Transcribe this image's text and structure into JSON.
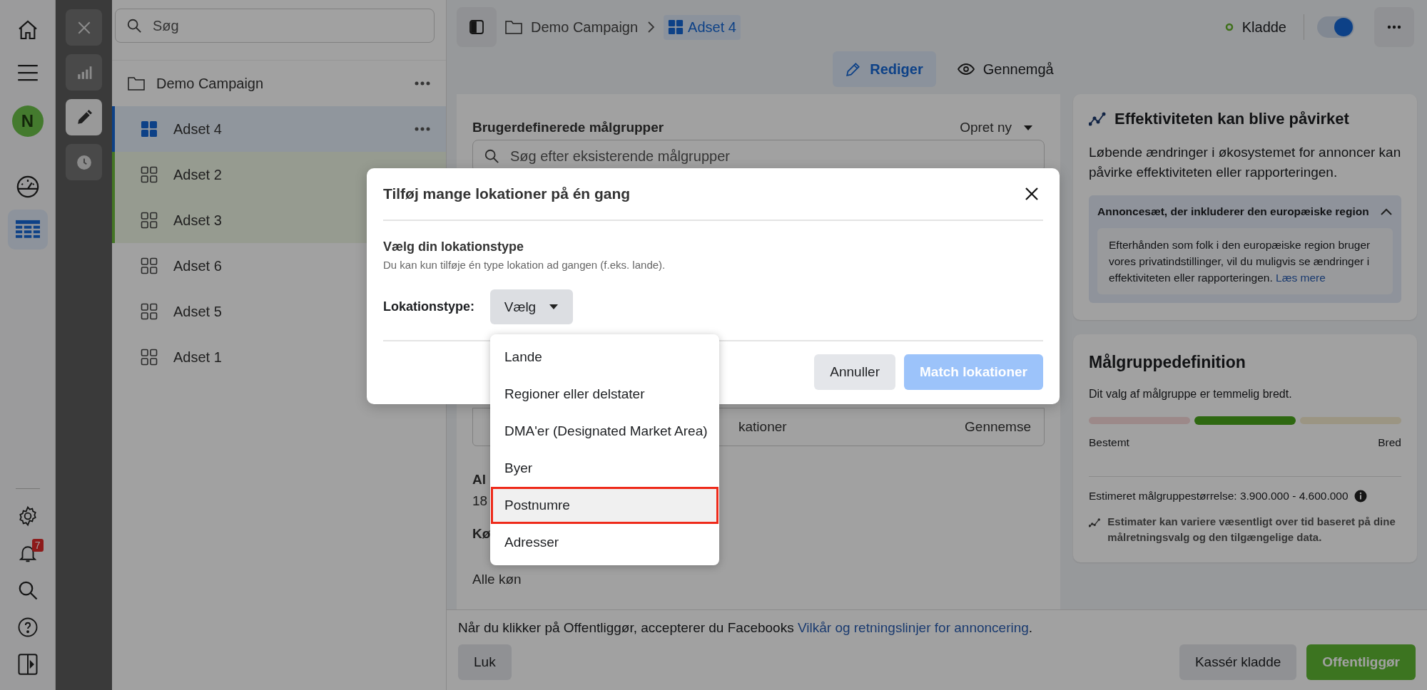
{
  "rail": {
    "top": [
      {
        "kind": "home",
        "selected": false
      },
      {
        "kind": "menu",
        "selected": false
      }
    ],
    "avatar": "N",
    "nav": [
      {
        "kind": "gauge",
        "selected": false
      },
      {
        "kind": "table",
        "selected": true
      }
    ],
    "bottom": [
      {
        "kind": "settings"
      },
      {
        "kind": "bell",
        "badge": "7"
      },
      {
        "kind": "search"
      },
      {
        "kind": "help"
      },
      {
        "kind": "panel"
      }
    ]
  },
  "tools": [
    {
      "kind": "close",
      "selected": false
    },
    {
      "kind": "chart",
      "selected": false
    },
    {
      "kind": "edit",
      "selected": true
    },
    {
      "kind": "history",
      "selected": false
    }
  ],
  "tree": {
    "search_placeholder": "Søg",
    "campaign": "Demo Campaign",
    "adsets": [
      {
        "label": "Adset 4",
        "selected": true,
        "edited": false
      },
      {
        "label": "Adset 2",
        "selected": false,
        "edited": true
      },
      {
        "label": "Adset 3",
        "selected": false,
        "edited": true
      },
      {
        "label": "Adset 6",
        "selected": false,
        "edited": false
      },
      {
        "label": "Adset 5",
        "selected": false,
        "edited": false
      },
      {
        "label": "Adset 1",
        "selected": false,
        "edited": false
      }
    ]
  },
  "topbar": {
    "campaign": "Demo Campaign",
    "adset": "Adset 4",
    "status": "Kladde",
    "toggle_on": true,
    "tabs": [
      {
        "kind": "edit",
        "label": "Rediger",
        "selected": true
      },
      {
        "kind": "review",
        "label": "Gennemgå",
        "selected": false
      }
    ]
  },
  "editor": {
    "audiences_title": "Brugerdefinerede målgrupper",
    "create": "Opret ny",
    "audiences_placeholder": "Søg efter eksisterende målgrupper",
    "locations_fragment": "kationer",
    "locations_action": "Gennemse",
    "age_label": "Al",
    "age_value": "18",
    "gender_label": "Kø",
    "gender_value": "Alle køn"
  },
  "insight": {
    "title": "Effektiviteten kan blive påvirket",
    "text": "Løbende ændringer i økosystemet for annoncer kan påvirke effektiviteten eller rapporteringen.",
    "accordion": {
      "title": "Annoncesæt, der inkluderer den europæiske region",
      "expanded": true,
      "text": "Efterhånden som folk i den europæiske region bruger vores privatindstillinger, vil du muligvis se ændringer i effektiviteten eller rapporteringen. ",
      "link": "Læs mere"
    }
  },
  "audience": {
    "title": "Målgruppedefinition",
    "text": "Dit valg af målgruppe er temmelig bredt.",
    "segments": [
      {
        "kind": "narrow",
        "selected": false
      },
      {
        "kind": "balanced",
        "selected": true
      },
      {
        "kind": "broad",
        "selected": false
      }
    ],
    "low": "Bestemt",
    "high": "Bred",
    "estimate": "Estimeret målgruppestørrelse: 3.900.000 - 4.600.000",
    "note": "Estimater kan variere væsentligt over tid baseret på dine målretningsvalg og den tilgængelige data."
  },
  "footer": {
    "notice": "Når du klikker på Offentliggør, accepterer du Facebooks ",
    "link": "Vilkår og retningslinjer for annoncering",
    "notice_end": ".",
    "close": "Luk",
    "discard": "Kassér kladde",
    "publish": "Offentliggør"
  },
  "modal": {
    "title": "Tilføj mange lokationer på én gang",
    "heading": "Vælg din lokationstype",
    "hint": "Du kan kun tilføje én type lokation ad gangen (f.eks. lande).",
    "select_label": "Lokationstype:",
    "select_value": "Vælg",
    "open": true,
    "options": [
      {
        "label": "Lande",
        "highlighted": false
      },
      {
        "label": "Regioner eller delstater",
        "highlighted": false
      },
      {
        "label": "DMA'er (Designated Market Area)",
        "highlighted": false
      },
      {
        "label": "Byer",
        "highlighted": false
      },
      {
        "label": "Postnumre",
        "highlighted": true
      },
      {
        "label": "Adresser",
        "highlighted": false
      }
    ],
    "cancel": "Annuller",
    "confirm": "Match lokationer",
    "confirm_disabled": true
  }
}
